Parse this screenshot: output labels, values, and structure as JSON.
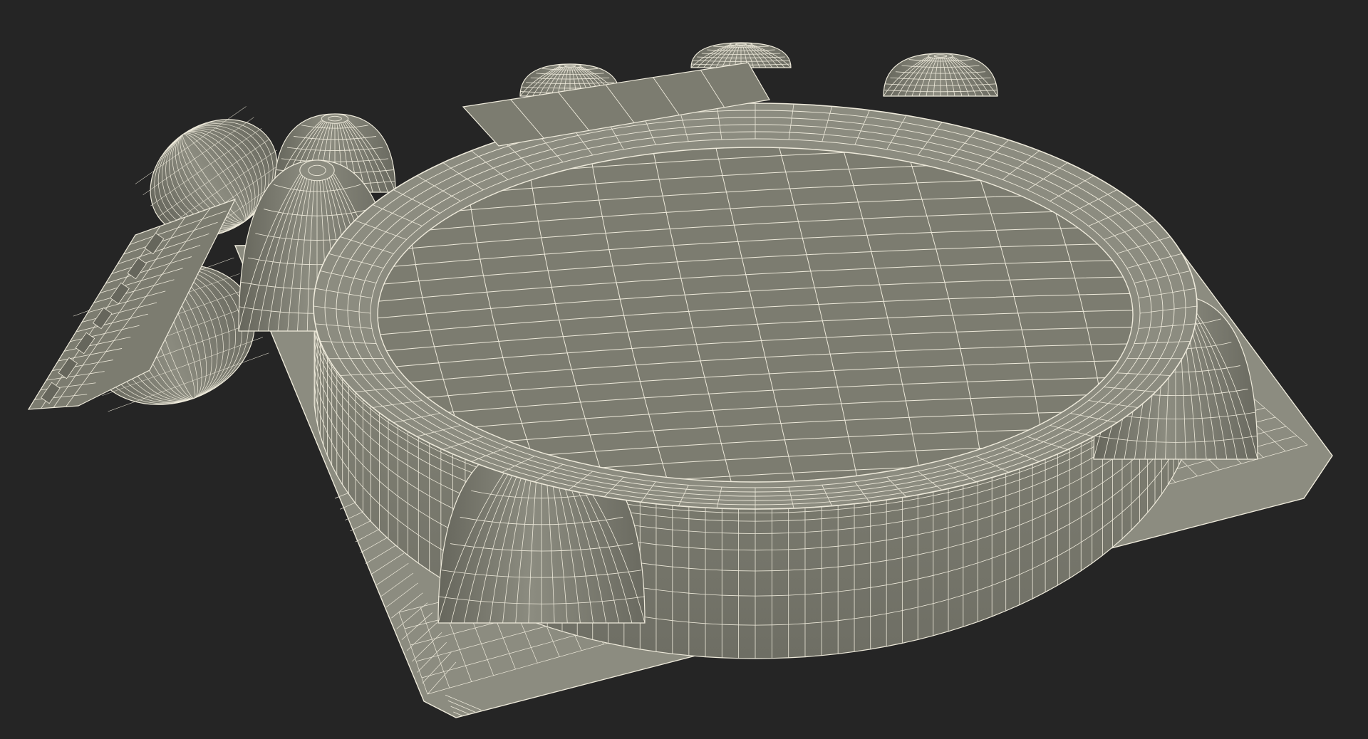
{
  "scene": {
    "colors": {
      "background": "#252525",
      "surface": "#7c7c70",
      "surface_light": "#8c8c80",
      "surface_dark": "#66665c",
      "wire": "#eeeadb"
    }
  }
}
